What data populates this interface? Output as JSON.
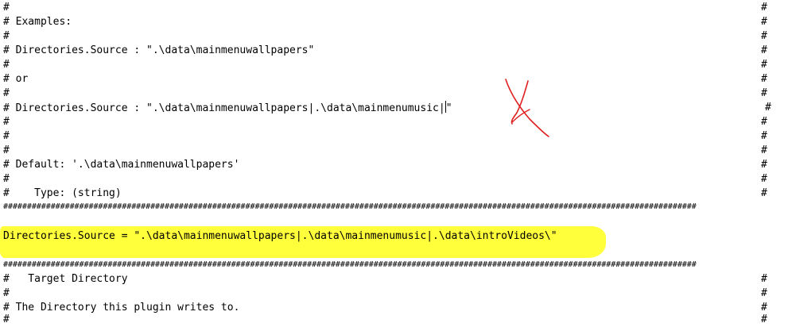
{
  "editor": {
    "comment_char": "#",
    "lines": {
      "l0": "#",
      "l1": "# Examples:",
      "l2": "#",
      "l3": "# Directories.Source : \".\\data\\mainmenuwallpapers\"",
      "l4": "#",
      "l5": "# or",
      "l6": "#",
      "l7_a": "# Directories.Source : \".\\data\\mainmenuwallpapers|.\\data\\mainmenumusic|",
      "l7_b": "\"",
      "l8": "#",
      "l9": "#",
      "l10": "#",
      "l11": "# Default: '.\\data\\mainmenuwallpapers'",
      "l12": "#",
      "l13": "#    Type: (string)",
      "setting": "Directories.Source = \".\\data\\mainmenuwallpapers|.\\data\\mainmenumusic|.\\data\\introVideos\\\"",
      "l16": "#   Target Directory",
      "l17": "#",
      "l18": "# The Directory this plugin writes to.",
      "l19": "#"
    },
    "banner": "##################################################################################################################################################"
  },
  "annotations": {
    "highlight_color": "#ffff3c",
    "mark_color": "#e02020",
    "mark_icon": "red-x-mark"
  }
}
